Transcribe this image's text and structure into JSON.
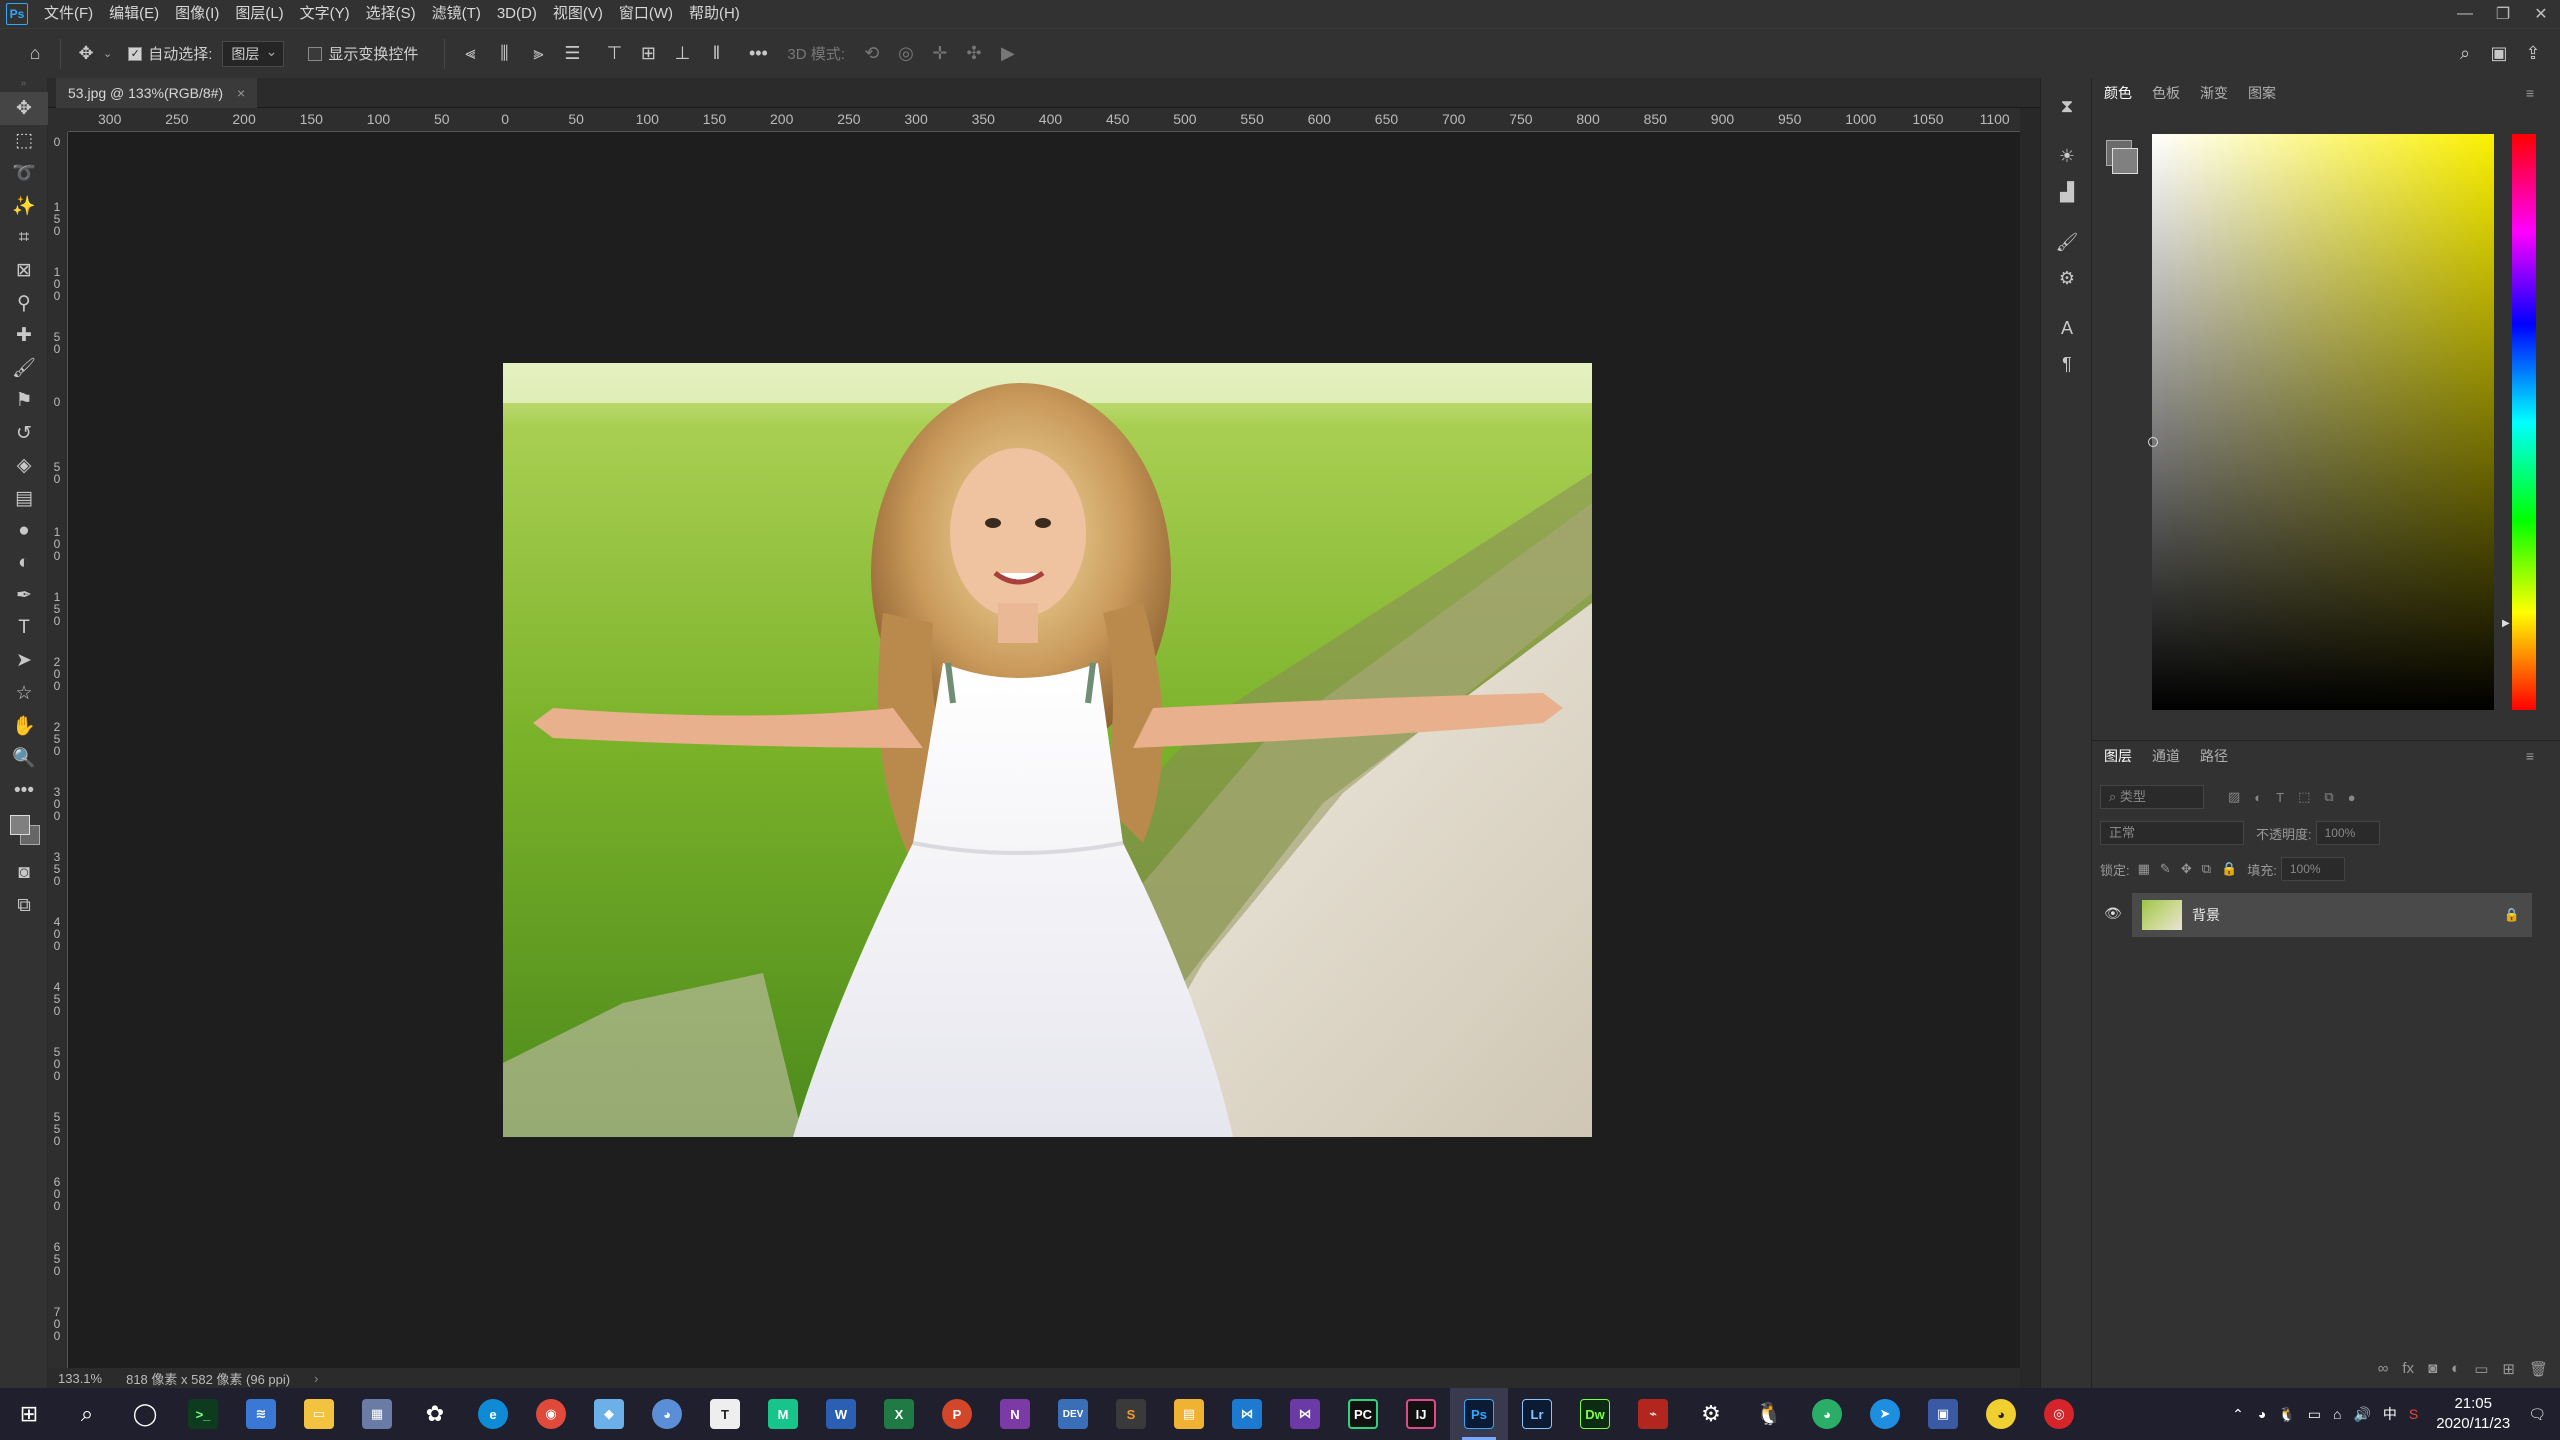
{
  "menubar": {
    "logo": "Ps",
    "items": [
      "文件(F)",
      "编辑(E)",
      "图像(I)",
      "图层(L)",
      "文字(Y)",
      "选择(S)",
      "滤镜(T)",
      "3D(D)",
      "视图(V)",
      "窗口(W)",
      "帮助(H)"
    ]
  },
  "optionsbar": {
    "auto_select_label": "自动选择:",
    "auto_select_target": "图层",
    "show_transform_label": "显示变换控件",
    "mode_3d_label": "3D 模式:"
  },
  "document": {
    "tab_title": "53.jpg @ 133%(RGB/8#)",
    "close_glyph": "×"
  },
  "rulers": {
    "top_labels": [
      "300",
      "250",
      "200",
      "150",
      "100",
      "50",
      "0",
      "50",
      "100",
      "150",
      "200",
      "250",
      "300",
      "350",
      "400",
      "450",
      "500",
      "550",
      "600",
      "650",
      "700",
      "750",
      "800",
      "850",
      "900",
      "950",
      "1000",
      "1050",
      "1100"
    ],
    "left_labels": [
      "0",
      "1\n5\n0",
      "1\n0\n0",
      "5\n0",
      "0",
      "5\n0",
      "1\n0\n0",
      "1\n5\n0",
      "2\n0\n0",
      "2\n5\n0",
      "3\n0\n0",
      "3\n5\n0",
      "4\n0\n0",
      "4\n5\n0",
      "5\n0\n0",
      "5\n5\n0",
      "6\n0\n0",
      "6\n5\n0",
      "7\n0\n0"
    ]
  },
  "status": {
    "zoom": "133.1%",
    "dimensions": "818 像素 x 582 像素 (96 ppi)"
  },
  "color_panel": {
    "tabs": [
      "颜色",
      "色板",
      "渐变",
      "图案"
    ],
    "active_tab": "颜色",
    "hue_color": "#fbf000"
  },
  "layers_panel": {
    "tabs": [
      "图层",
      "通道",
      "路径"
    ],
    "active_tab": "图层",
    "filter_placeholder": "类型",
    "blend_mode": "正常",
    "opacity_label": "不透明度:",
    "opacity_value": "100%",
    "lock_label": "锁定:",
    "fill_label": "填充:",
    "fill_value": "100%",
    "layers": [
      {
        "name": "背景",
        "visible": true,
        "locked": true
      }
    ]
  },
  "taskbar": {
    "clock_time": "21:05",
    "clock_date": "2020/11/23",
    "ime_label": "中"
  }
}
